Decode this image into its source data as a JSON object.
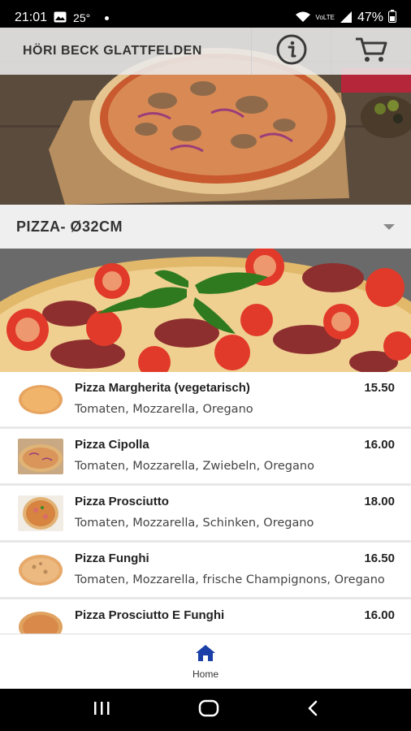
{
  "status_bar": {
    "time": "21:01",
    "temperature": "25°",
    "battery": "47%",
    "icons": [
      "photo-icon",
      "dot-icon",
      "wifi-icon",
      "volte-icon",
      "signal-icon",
      "battery-icon"
    ]
  },
  "header": {
    "title": "HÖRI BECK GLATTFELDEN",
    "info_icon": "info-icon",
    "cart_icon": "cart-icon"
  },
  "category": {
    "label": "PIZZA- Ø32CM",
    "icon": "chevron-down-icon"
  },
  "menu_items": [
    {
      "name": "Pizza Margherita (vegetarisch)",
      "price": "15.50",
      "description": "Tomaten, Mozzarella, Oregano"
    },
    {
      "name": "Pizza Cipolla",
      "price": "16.00",
      "description": "Tomaten, Mozzarella, Zwiebeln, Oregano"
    },
    {
      "name": "Pizza Prosciutto",
      "price": "18.00",
      "description": "Tomaten, Mozzarella, Schinken, Oregano"
    },
    {
      "name": "Pizza Funghi",
      "price": "16.50",
      "description": "Tomaten, Mozzarella, frische Champignons, Oregano"
    },
    {
      "name": "Pizza Prosciutto E Funghi",
      "price": "16.00",
      "description": ""
    }
  ],
  "bottom_nav": {
    "home_label": "Home",
    "home_icon": "home-icon"
  },
  "system_nav": {
    "icons": [
      "recents-icon",
      "home-circle-icon",
      "back-icon"
    ]
  },
  "colors": {
    "accent": "#1a3fa8",
    "header_bg": "#ebebeb",
    "category_bg": "#efefef"
  }
}
